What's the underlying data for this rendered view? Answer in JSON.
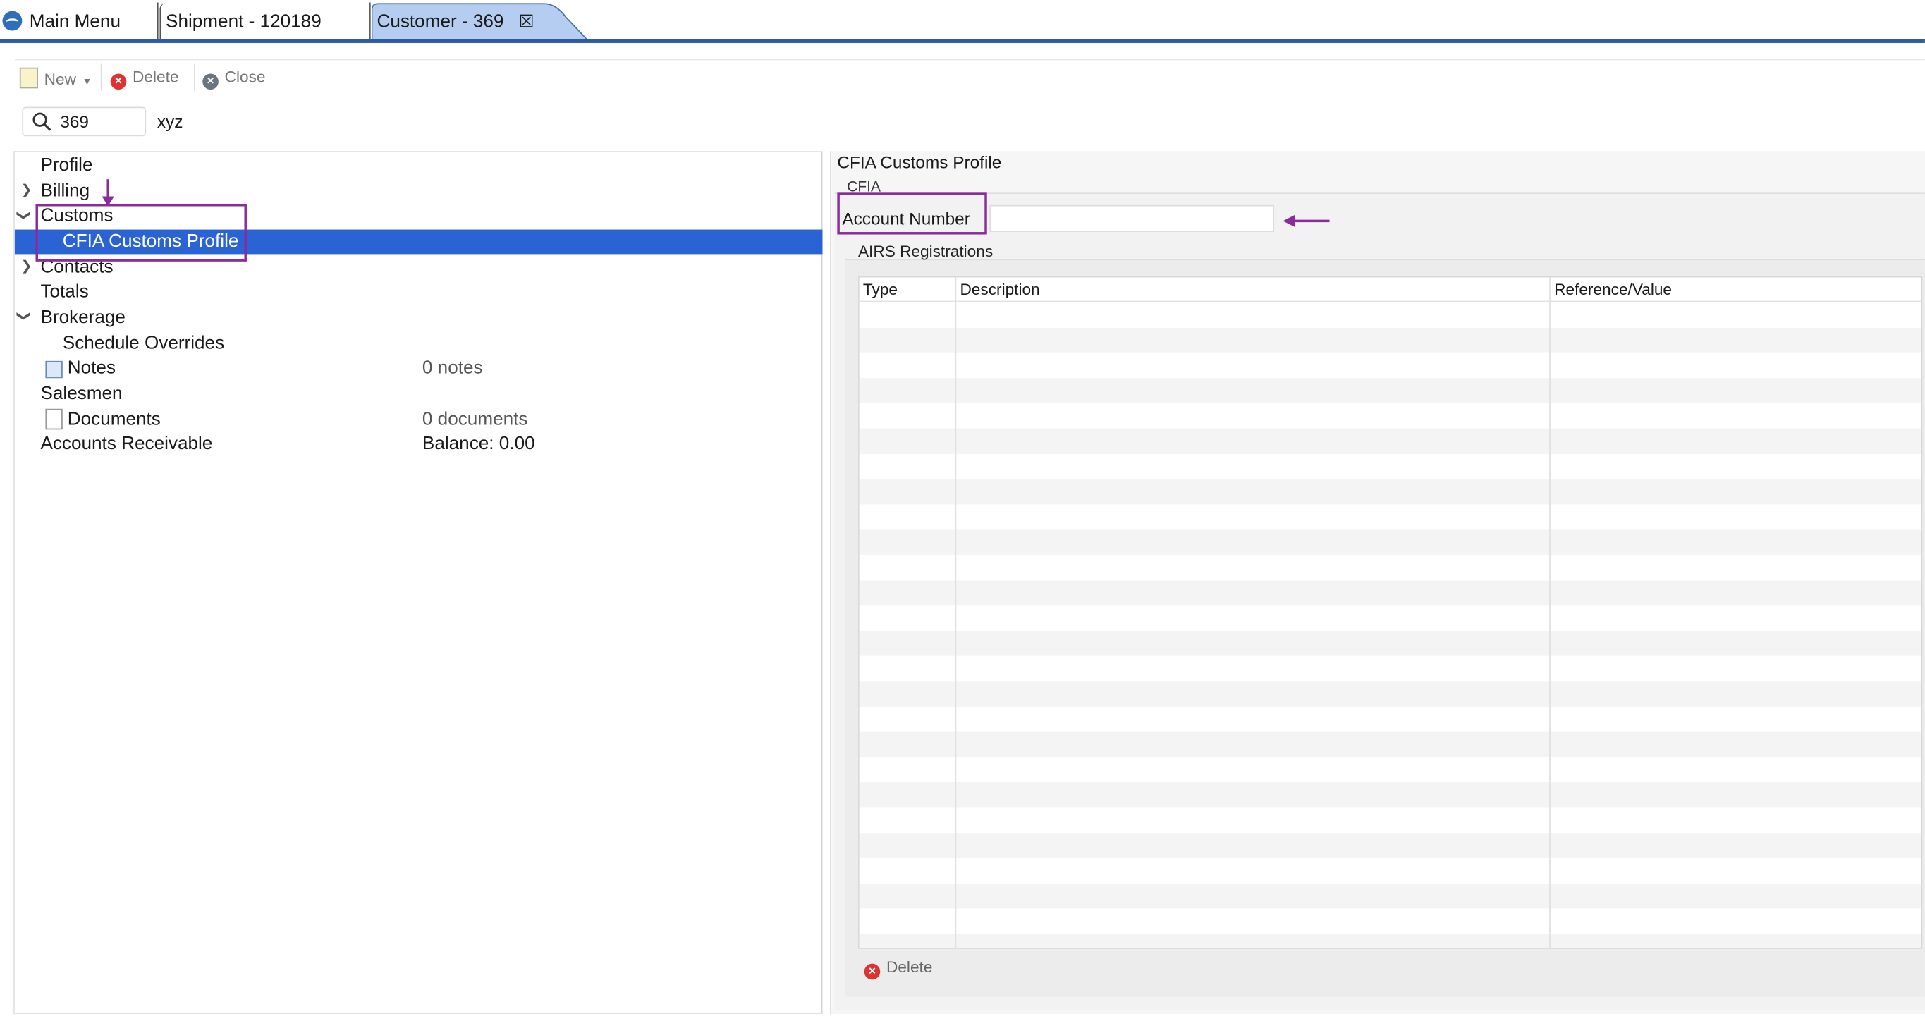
{
  "tabs": [
    {
      "label": "Main Menu"
    },
    {
      "label": "Shipment - 120189"
    },
    {
      "label": "Customer - 369"
    }
  ],
  "toolbar": {
    "new_label": "New",
    "delete_label": "Delete",
    "close_label": "Close"
  },
  "search": {
    "value": "369",
    "name": "xyz"
  },
  "tree": {
    "profile": "Profile",
    "billing": "Billing",
    "customs": "Customs",
    "cfia": "CFIA Customs Profile",
    "contacts": "Contacts",
    "totals": "Totals",
    "brokerage": "Brokerage",
    "schedule_overrides": "Schedule Overrides",
    "notes": "Notes",
    "notes_count": "0 notes",
    "salesmen": "Salesmen",
    "documents": "Documents",
    "documents_count": "0 documents",
    "ar": "Accounts Receivable",
    "ar_balance": "Balance: 0.00"
  },
  "detail": {
    "title": "CFIA Customs Profile",
    "group": "CFIA",
    "account_label": "Account Number",
    "account_value": "",
    "airs_title": "AIRS Registrations",
    "columns": [
      "Type",
      "Description",
      "Reference/Value"
    ],
    "delete_label": "Delete"
  },
  "colors": {
    "accent": "#2a63d4",
    "annotation": "#8a2c9a"
  }
}
